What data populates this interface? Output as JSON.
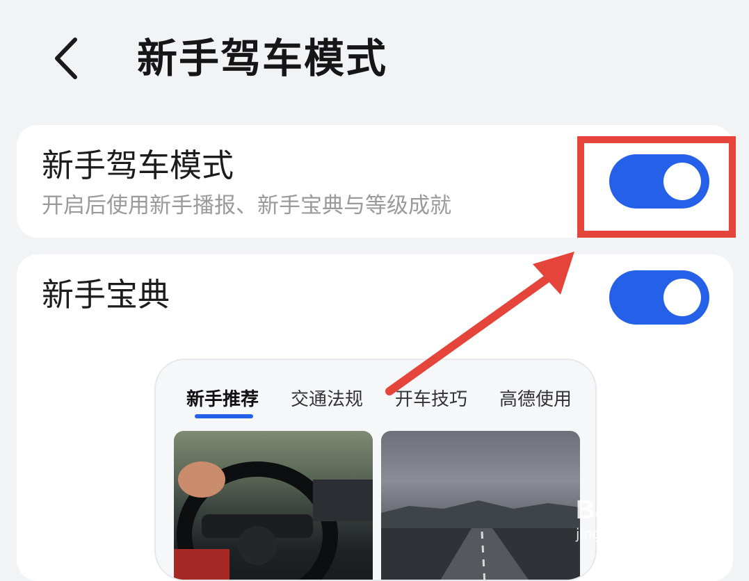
{
  "header": {
    "title": "新手驾车模式"
  },
  "settings": {
    "novice_mode": {
      "title": "新手驾车模式",
      "subtitle": "开启后使用新手播报、新手宝典与等级成就",
      "enabled": true
    },
    "handbook": {
      "title": "新手宝典",
      "enabled": true
    }
  },
  "preview": {
    "tabs": [
      {
        "label": "新手推荐",
        "active": true
      },
      {
        "label": "交通法规",
        "active": false
      },
      {
        "label": "开车技巧",
        "active": false
      },
      {
        "label": "高德使用",
        "active": false
      }
    ]
  },
  "watermark": {
    "logo": "Baidu经验",
    "url": "jingyan.baidu.com"
  },
  "colors": {
    "accent": "#2560e8",
    "annotation": "#e4443a",
    "background": "#f1f3f5"
  },
  "icons": {
    "back": "chevron-left-icon"
  }
}
